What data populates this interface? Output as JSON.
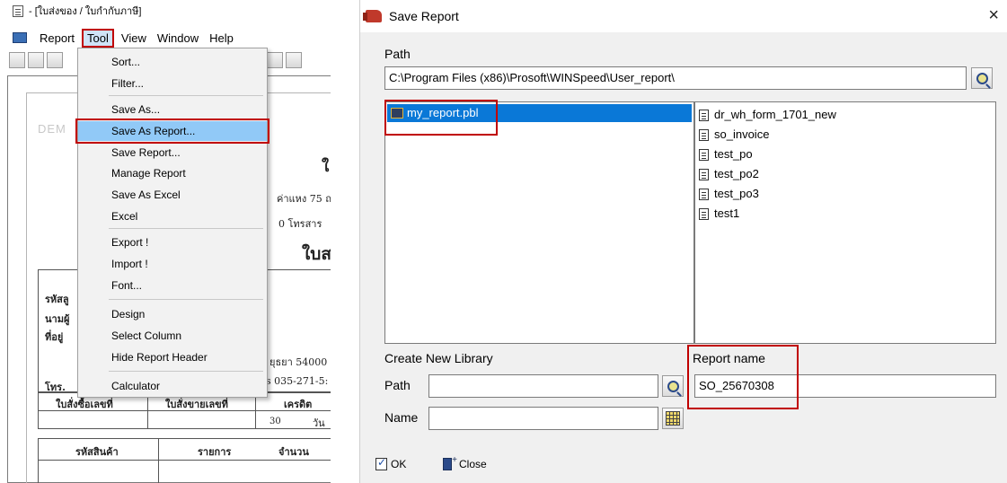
{
  "left_window": {
    "title": "- [ใบส่งของ / ใบกำกับภาษี]",
    "menu": [
      "Report",
      "Tool",
      "View",
      "Window",
      "Help"
    ],
    "dropdown_items": [
      "Sort...",
      "Filter...",
      "Save As...",
      "Save As Report...",
      "Save Report...",
      "Manage Report",
      "Save As Excel",
      "Excel",
      "Export !",
      "Import !",
      "Font...",
      "Design",
      "Select Column",
      "Hide Report Header",
      "Calculator"
    ],
    "document": {
      "watermark": "DEM",
      "heading_char": "ใ",
      "address_fragment": "ค่าแหง 75 ถ.",
      "fax_fragment": "0  โทรสาร",
      "title_fragment": "ใบส",
      "customer_code_label": "รหัสลู",
      "customer_name_label": "นามผู้",
      "address_label": "ที่อยู่",
      "province_fragment": "ยุธยา 54000",
      "phone_label": "โทร.",
      "phone_fragment": "s 035-271-5:",
      "col_order_no": "ใบสั่งซื้อเลขที่",
      "col_sale_no": "ใบสั่งขายเลขที่",
      "col_credit": "เครดิต",
      "credit_days": "30",
      "day_label": "วัน",
      "col_product_code": "รหัสสินค้า",
      "col_item": "รายการ",
      "col_qty": "จำนวน"
    }
  },
  "dialog": {
    "title": "Save Report",
    "close_glyph": "×",
    "path_label": "Path",
    "path_value": "C:\\Program Files (x86)\\Prosoft\\WINSpeed\\User_report\\",
    "libraries": [
      "my_report.pbl"
    ],
    "reports": [
      "dr_wh_form_1701_new",
      "so_invoice",
      "test_po",
      "test_po2",
      "test_po3",
      "test1"
    ],
    "create_new_library_label": "Create New Library",
    "new_path_label": "Path",
    "new_path_value": "",
    "new_name_label": "Name",
    "new_name_value": "",
    "report_name_label": "Report name",
    "report_name_value": "SO_25670308",
    "ok_label": "OK",
    "close_label": "Close"
  },
  "colors": {
    "highlight_border": "#c00000",
    "selection_blue": "#0a78d7",
    "menu_hover": "#91c9f7"
  }
}
